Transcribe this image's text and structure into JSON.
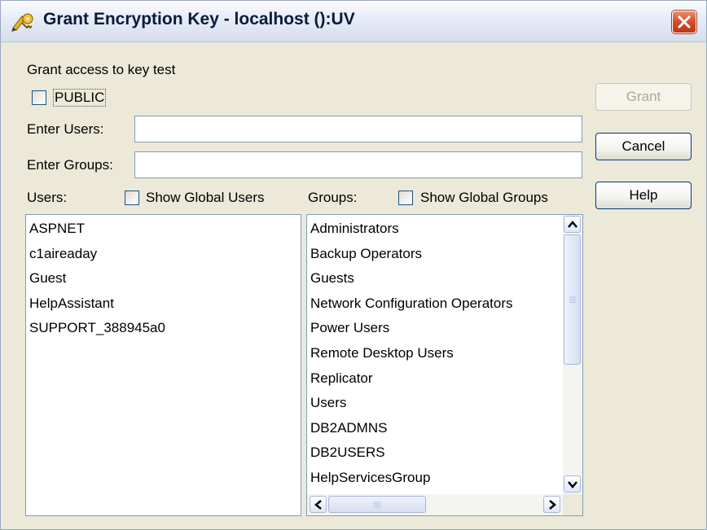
{
  "window": {
    "title": "Grant Encryption Key - localhost ():UV"
  },
  "form": {
    "grant_access_label": "Grant access to key test",
    "public_checkbox_label": "PUBLIC",
    "enter_users_label": "Enter Users:",
    "enter_groups_label": "Enter Groups:",
    "enter_users_value": "",
    "enter_groups_value": "",
    "users_label": "Users:",
    "show_global_users_label": "Show Global Users",
    "groups_label": "Groups:",
    "show_global_groups_label": "Show Global Groups"
  },
  "users_list": [
    "ASPNET",
    "c1aireaday",
    "Guest",
    "HelpAssistant",
    "SUPPORT_388945a0"
  ],
  "groups_list": [
    "Administrators",
    "Backup Operators",
    "Guests",
    "Network Configuration Operators",
    "Power Users",
    "Remote Desktop Users",
    "Replicator",
    "Users",
    "DB2ADMNS",
    "DB2USERS",
    "HelpServicesGroup"
  ],
  "buttons": {
    "grant": "Grant",
    "cancel": "Cancel",
    "help": "Help"
  },
  "colors": {
    "dialog_bg": "#ece9d8",
    "close_button": "#cf4a24",
    "field_border": "#7f9db9"
  },
  "icons": {
    "app": "key-pen-icon",
    "close": "close-icon"
  }
}
